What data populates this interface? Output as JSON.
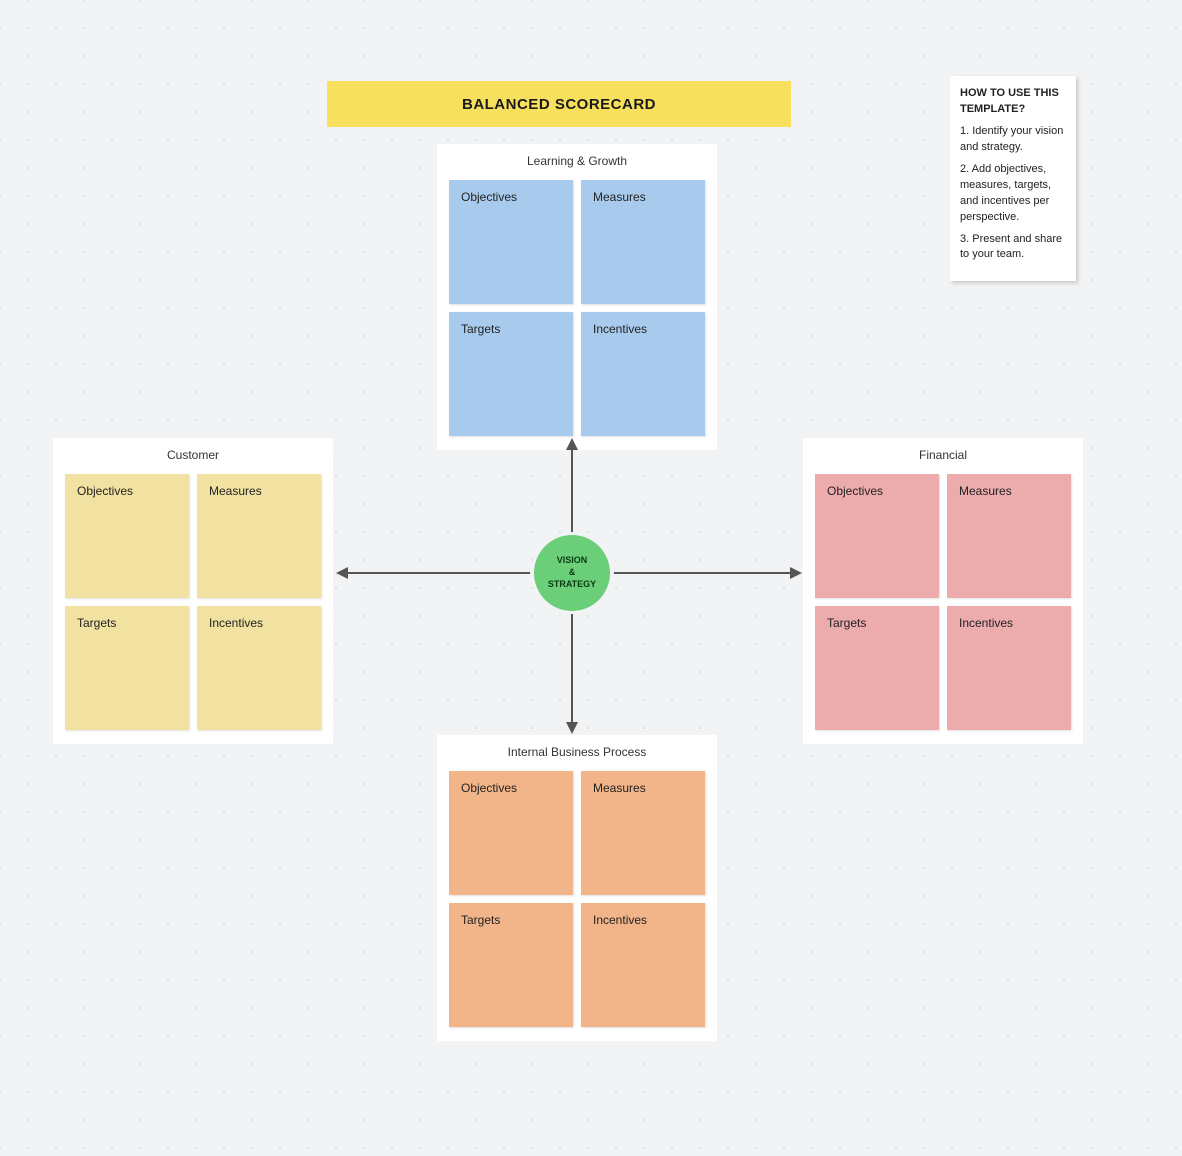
{
  "title": "BALANCED SCORECARD",
  "center": {
    "line1": "VISION",
    "line2": "&",
    "line3": "STRATEGY"
  },
  "help": {
    "title": "HOW TO USE THIS TEMPLATE?",
    "step1": "1. Identify your vision and strategy.",
    "step2": "2. Add objectives, measures, targets, and incentives per perspective.",
    "step3": "3. Present and share to your team."
  },
  "quadrants": {
    "top": {
      "title": "Learning & Growth",
      "cards": {
        "c1": "Objectives",
        "c2": "Measures",
        "c3": "Targets",
        "c4": "Incentives"
      }
    },
    "left": {
      "title": "Customer",
      "cards": {
        "c1": "Objectives",
        "c2": "Measures",
        "c3": "Targets",
        "c4": "Incentives"
      }
    },
    "right": {
      "title": "Financial",
      "cards": {
        "c1": "Objectives",
        "c2": "Measures",
        "c3": "Targets",
        "c4": "Incentives"
      }
    },
    "bottom": {
      "title": "Internal Business Process",
      "cards": {
        "c1": "Objectives",
        "c2": "Measures",
        "c3": "Targets",
        "c4": "Incentives"
      }
    }
  }
}
